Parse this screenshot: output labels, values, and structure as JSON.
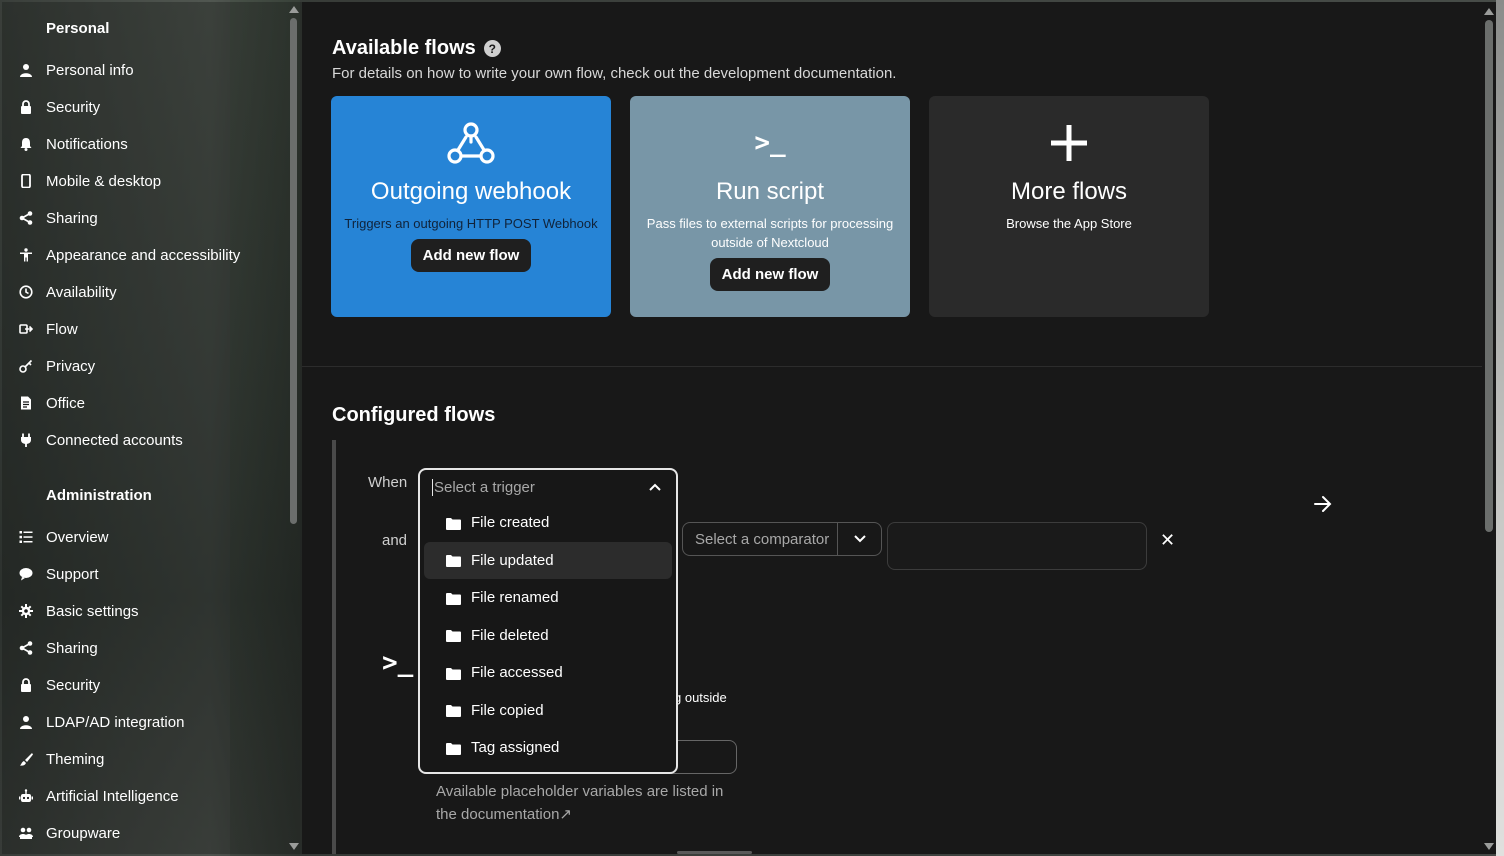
{
  "sidebar": {
    "personal_heading": "Personal",
    "personal_items": [
      {
        "label": "Personal info",
        "icon": "person-icon"
      },
      {
        "label": "Security",
        "icon": "lock-icon"
      },
      {
        "label": "Notifications",
        "icon": "bell-icon"
      },
      {
        "label": "Mobile & desktop",
        "icon": "phone-icon"
      },
      {
        "label": "Sharing",
        "icon": "share-icon"
      },
      {
        "label": "Appearance and accessibility",
        "icon": "accessibility-icon"
      },
      {
        "label": "Availability",
        "icon": "clock-icon"
      },
      {
        "label": "Flow",
        "icon": "flow-icon"
      },
      {
        "label": "Privacy",
        "icon": "key-icon"
      },
      {
        "label": "Office",
        "icon": "document-icon"
      },
      {
        "label": "Connected accounts",
        "icon": "plug-icon"
      }
    ],
    "admin_heading": "Administration",
    "admin_items": [
      {
        "label": "Overview",
        "icon": "list-icon"
      },
      {
        "label": "Support",
        "icon": "chat-icon"
      },
      {
        "label": "Basic settings",
        "icon": "gear-icon"
      },
      {
        "label": "Sharing",
        "icon": "share-icon"
      },
      {
        "label": "Security",
        "icon": "lock-icon"
      },
      {
        "label": "LDAP/AD integration",
        "icon": "person-icon"
      },
      {
        "label": "Theming",
        "icon": "brush-icon"
      },
      {
        "label": "Artificial Intelligence",
        "icon": "robot-icon"
      },
      {
        "label": "Groupware",
        "icon": "group-icon"
      }
    ]
  },
  "available_flows": {
    "title": "Available flows",
    "help": "?",
    "description": "For details on how to write your own flow, check out the development documentation.",
    "cards": [
      {
        "title": "Outgoing webhook",
        "description": "Triggers an outgoing HTTP POST Webhook",
        "button": "Add new flow",
        "color": "#2684d6"
      },
      {
        "title": "Run script",
        "description": "Pass files to external scripts for processing outside of Nextcloud",
        "button": "Add new flow",
        "color": "#7896a7"
      },
      {
        "title": "More flows",
        "description": "Browse the App Store",
        "color": "#2a2a2a"
      }
    ],
    "script_icon_text": ">_"
  },
  "configured_flows": {
    "title": "Configured flows",
    "when_label": "When",
    "and_label": "and",
    "trigger_placeholder": "Select a trigger",
    "trigger_options": [
      "File created",
      "File updated",
      "File renamed",
      "File deleted",
      "File accessed",
      "File copied",
      "Tag assigned"
    ],
    "comparator_placeholder": "Select a comparator",
    "remove_symbol": "✕",
    "script_icon_text": ">_",
    "partial_description": "g outside",
    "placeholder_note": "Available placeholder variables are listed in the documentation↗"
  }
}
